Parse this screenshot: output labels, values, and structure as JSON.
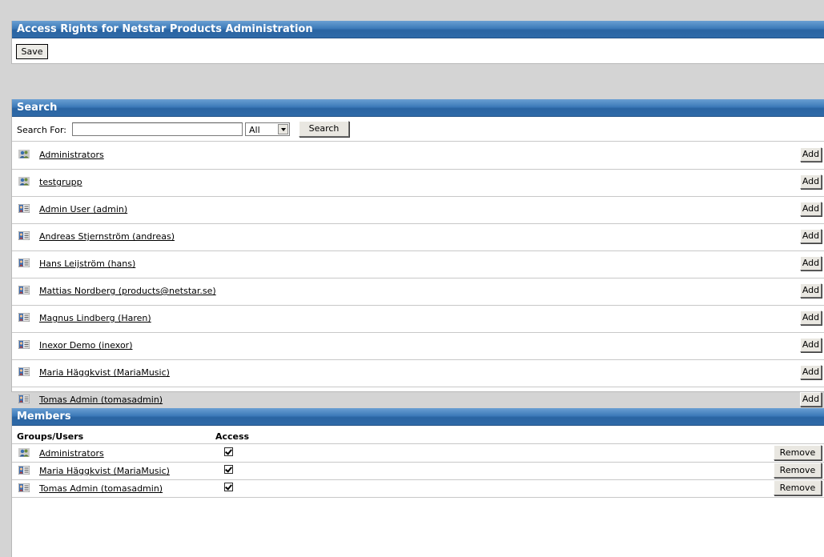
{
  "header": {
    "title": "Access Rights for Netstar Products Administration",
    "save_label": "Save"
  },
  "search": {
    "title": "Search",
    "label": "Search For:",
    "input_value": "",
    "select_value": "All",
    "button_label": "Search",
    "results": [
      {
        "type": "group",
        "icon": "group-icon",
        "name": "Administrators",
        "action": "Add"
      },
      {
        "type": "group",
        "icon": "group-icon",
        "name": "testgrupp",
        "action": "Add"
      },
      {
        "type": "user",
        "icon": "user-icon",
        "name": "Admin User (admin)",
        "action": "Add"
      },
      {
        "type": "user",
        "icon": "user-icon",
        "name": "Andreas Stjernström (andreas)",
        "action": "Add"
      },
      {
        "type": "user",
        "icon": "user-icon",
        "name": "Hans Leijström (hans)",
        "action": "Add"
      },
      {
        "type": "user",
        "icon": "user-icon",
        "name": "Mattias Nordberg (products@netstar.se)",
        "action": "Add"
      },
      {
        "type": "user",
        "icon": "user-icon",
        "name": "Magnus Lindberg (Haren)",
        "action": "Add"
      },
      {
        "type": "user",
        "icon": "user-icon",
        "name": "Inexor Demo (inexor)",
        "action": "Add"
      },
      {
        "type": "user",
        "icon": "user-icon",
        "name": "Maria Häggkvist (MariaMusic)",
        "action": "Add"
      },
      {
        "type": "user",
        "icon": "user-icon",
        "name": "Tomas Admin (tomasadmin)",
        "action": "Add"
      }
    ]
  },
  "members": {
    "title": "Members",
    "col_groups_users": "Groups/Users",
    "col_access": "Access",
    "rows": [
      {
        "type": "group",
        "icon": "group-icon",
        "name": "Administrators",
        "access": true,
        "action": "Remove"
      },
      {
        "type": "user",
        "icon": "user-icon",
        "name": "Maria Häggkvist (MariaMusic)",
        "access": true,
        "action": "Remove"
      },
      {
        "type": "user",
        "icon": "user-icon",
        "name": "Tomas Admin (tomasadmin)",
        "access": true,
        "action": "Remove"
      }
    ]
  }
}
